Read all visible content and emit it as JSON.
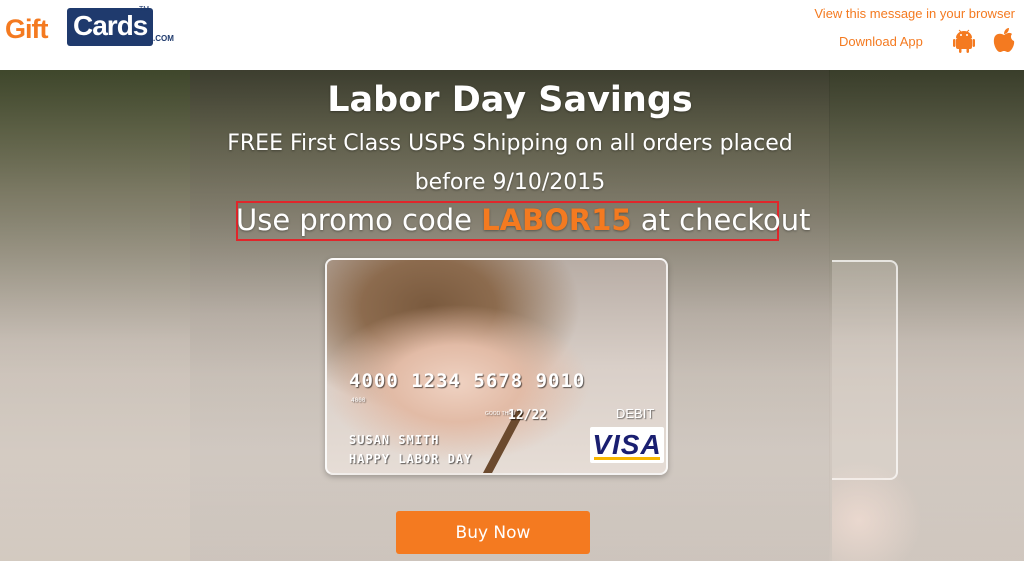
{
  "header": {
    "logo": {
      "gift": "Gift",
      "cards": "Cards",
      "tm": "TM",
      "com": ".COM"
    },
    "view_in_browser": "View this message in your browser",
    "download_app": "Download App",
    "icons": {
      "android": "android-icon",
      "apple": "apple-icon"
    }
  },
  "hero": {
    "headline": "Labor Day Savings",
    "subline_1": "FREE First Class USPS Shipping on all orders placed",
    "subline_2": "before 9/10/2015",
    "promo_prefix": "Use promo code ",
    "promo_code": "LABOR15",
    "promo_suffix": " at checkout",
    "card": {
      "number": "4000 1234 5678 9010",
      "small_digits": "4000",
      "good_thru_label": "GOOD THRU",
      "expiry": "12/22",
      "debit": "DEBIT",
      "name": "SUSAN SMITH",
      "message": "HAPPY LABOR DAY",
      "network": "VISA"
    },
    "buy_button": "Buy Now"
  },
  "colors": {
    "accent": "#f47a20",
    "brand_navy": "#1f3a6d",
    "promo_border": "#e0262b",
    "visa_blue": "#1a1f71"
  }
}
